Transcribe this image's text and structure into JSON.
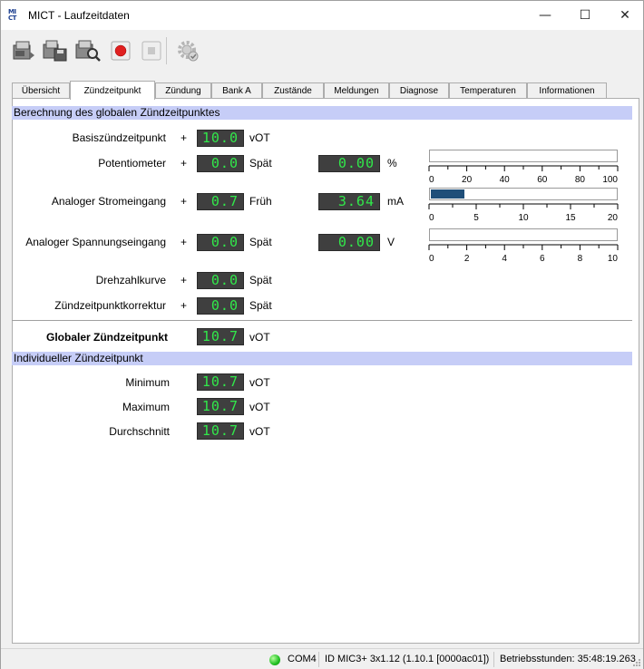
{
  "window": {
    "title": "MICT - Laufzeitdaten",
    "logo_top": "MI",
    "logo_bottom": "CT"
  },
  "window_controls": {
    "minimize": "—",
    "maximize": "☐",
    "close": "✕"
  },
  "toolbar": {
    "buttons": [
      {
        "icon": "read-device-icon"
      },
      {
        "icon": "save-device-icon"
      },
      {
        "icon": "search-device-icon"
      },
      {
        "icon": "record-icon"
      },
      {
        "icon": "stop-icon"
      },
      {
        "icon": "settings-icon"
      }
    ]
  },
  "tabs": [
    {
      "label": "Übersicht",
      "active": false
    },
    {
      "label": "Zündzeitpunkt",
      "active": true
    },
    {
      "label": "Zündung",
      "active": false
    },
    {
      "label": "Bank A",
      "active": false
    },
    {
      "label": "Zustände",
      "active": false
    },
    {
      "label": "Meldungen",
      "active": false
    },
    {
      "label": "Diagnose",
      "active": false
    },
    {
      "label": "Temperaturen",
      "active": false
    },
    {
      "label": "Informationen",
      "active": false
    }
  ],
  "global_section": {
    "header": "Berechnung des globalen Zündzeitpunktes",
    "rows": [
      {
        "label": "Basiszündzeitpunkt",
        "sign": "+",
        "value": "10.0",
        "unit": "vOT"
      },
      {
        "label": "Potentiometer",
        "sign": "+",
        "value": "0.0",
        "unit": "Spät",
        "aux_value": "0.00",
        "aux_unit": "%"
      },
      {
        "label": "Analoger Stromeingang",
        "sign": "+",
        "value": "0.7",
        "unit": "Früh",
        "aux_value": "3.64",
        "aux_unit": "mA"
      },
      {
        "label": "Analoger Spannungseingang",
        "sign": "+",
        "value": "0.0",
        "unit": "Spät",
        "aux_value": "0.00",
        "aux_unit": "V"
      },
      {
        "label": "Drehzahlkurve",
        "sign": "+",
        "value": "0.0",
        "unit": "Spät"
      },
      {
        "label": "Zündzeitpunktkorrektur",
        "sign": "+",
        "value": "0.0",
        "unit": "Spät"
      }
    ],
    "result": {
      "label": "Globaler Zündzeitpunkt",
      "value": "10.7",
      "unit": "vOT"
    }
  },
  "gauges": [
    {
      "ticks": [
        "0",
        "20",
        "40",
        "60",
        "80",
        "100"
      ],
      "max": 100,
      "value": 0
    },
    {
      "ticks": [
        "0",
        "5",
        "10",
        "15",
        "20"
      ],
      "max": 20,
      "value": 3.64
    },
    {
      "ticks": [
        "0",
        "2",
        "4",
        "6",
        "8",
        "10"
      ],
      "max": 10,
      "value": 0
    }
  ],
  "individual_section": {
    "header": "Individueller Zündzeitpunkt",
    "rows": [
      {
        "label": "Minimum",
        "value": "10.7",
        "unit": "vOT"
      },
      {
        "label": "Maximum",
        "value": "10.7",
        "unit": "vOT"
      },
      {
        "label": "Durchschnitt",
        "value": "10.7",
        "unit": "vOT"
      }
    ]
  },
  "statusbar": {
    "port": "COM4",
    "device": "ID MIC3+ 3x1.12 (1.10.1 [0000ac01])",
    "hours": "Betriebsstunden: 35:48:19.263"
  },
  "colors": {
    "section_header": "#c6cdf7",
    "segment_bg": "#3f3f3f",
    "segment_fg": "#31e84a",
    "gauge_fill": "#1f4e79",
    "status_led": "#1fbf21"
  }
}
